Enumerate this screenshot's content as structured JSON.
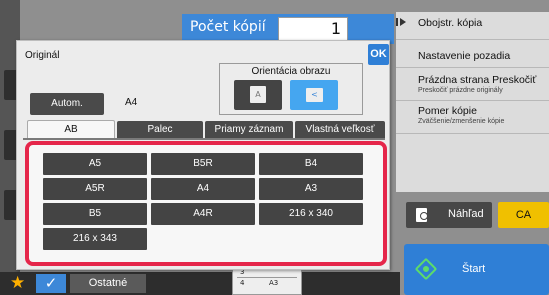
{
  "header": {
    "copies_label": "Počet kópií",
    "copies_value": "1"
  },
  "right_panel": {
    "items": [
      {
        "title": "Obojstr. kópia",
        "subtitle": ""
      },
      {
        "title": "Nastavenie pozadia",
        "subtitle": ""
      },
      {
        "title": "Prázdna strana Preskočiť",
        "subtitle": "Preskočiť prázdne originály"
      },
      {
        "title": "Pomer kópie",
        "subtitle": "Zväčšenie/zmenšenie kópie"
      }
    ],
    "preview_label": "Náhľad",
    "ca_label": "CA",
    "start_label": "Štart"
  },
  "bottom_bar": {
    "other_label": "Ostatné",
    "tray_top": "3",
    "tray_num": "4",
    "tray_size": "A3"
  },
  "dialog": {
    "title": "Originál",
    "ok_label": "OK",
    "orientation_title": "Orientácia obrazu",
    "orientation_selected": "landscape",
    "auto_label": "Autom.",
    "current_size": "A4",
    "tabs": [
      {
        "label": "AB",
        "active": true
      },
      {
        "label": "Palec",
        "active": false
      },
      {
        "label": "Priamy záznam",
        "active": false
      },
      {
        "label": "Vlastná veľkosť",
        "active": false
      }
    ],
    "sizes": [
      "A5",
      "B5R",
      "B4",
      "A5R",
      "A4",
      "A3",
      "B5",
      "A4R",
      "216 x 340",
      "216 x 343"
    ]
  },
  "colors": {
    "accent_blue": "#2f7fd6",
    "highlight_red": "#e5264a",
    "ca_yellow": "#f0c000",
    "start_green": "#5ddc6a"
  }
}
